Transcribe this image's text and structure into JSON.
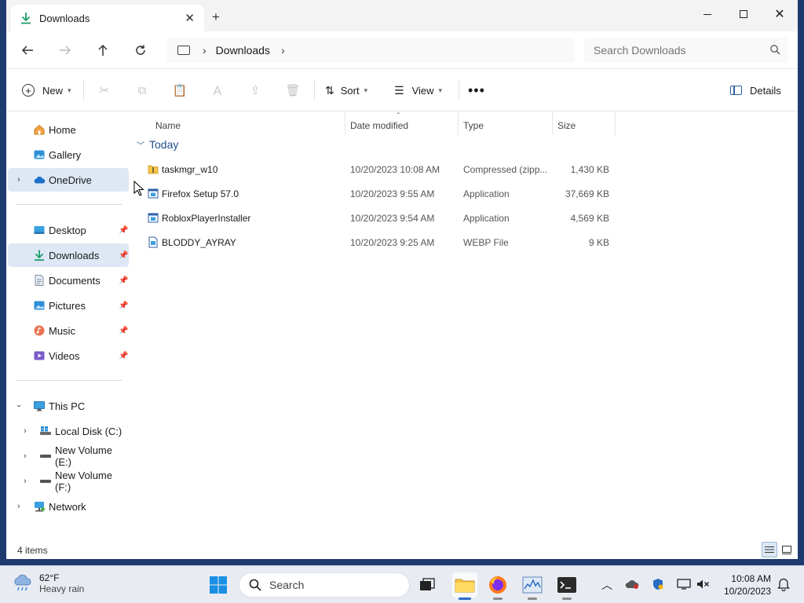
{
  "window": {
    "tab_title": "Downloads",
    "new_tab_symbol": "+"
  },
  "address_bar": {
    "crumbs": [
      "Downloads"
    ],
    "search_placeholder": "Search Downloads"
  },
  "toolbar": {
    "new_label": "New",
    "sort_label": "Sort",
    "view_label": "View",
    "more_label": "•••",
    "details_label": "Details"
  },
  "sidebar": {
    "quick": [
      {
        "label": "Home",
        "icon": "home-icon"
      },
      {
        "label": "Gallery",
        "icon": "gallery-icon"
      },
      {
        "label": "OneDrive",
        "icon": "cloud-icon"
      }
    ],
    "pinned": [
      {
        "label": "Desktop",
        "icon": "desktop-icon"
      },
      {
        "label": "Downloads",
        "icon": "download-icon",
        "selected": true
      },
      {
        "label": "Documents",
        "icon": "documents-icon"
      },
      {
        "label": "Pictures",
        "icon": "pictures-icon"
      },
      {
        "label": "Music",
        "icon": "music-icon"
      },
      {
        "label": "Videos",
        "icon": "videos-icon"
      }
    ],
    "devices": [
      {
        "label": "This PC",
        "icon": "pc-icon"
      },
      {
        "label": "Local Disk (C:)",
        "icon": "drive-icon"
      },
      {
        "label": "New Volume (E:)",
        "icon": "drive-icon"
      },
      {
        "label": "New Volume (F:)",
        "icon": "drive-icon"
      },
      {
        "label": "Network",
        "icon": "network-icon"
      }
    ]
  },
  "file_list": {
    "columns": [
      "Name",
      "Date modified",
      "Type",
      "Size"
    ],
    "group_label": "Today",
    "rows": [
      {
        "name": "taskmgr_w10",
        "date": "10/20/2023 10:08 AM",
        "type": "Compressed (zipp...",
        "size": "1,430 KB",
        "icon": "zip-folder-icon"
      },
      {
        "name": "Firefox Setup 57.0",
        "date": "10/20/2023 9:55 AM",
        "type": "Application",
        "size": "37,669 KB",
        "icon": "application-icon"
      },
      {
        "name": "RobloxPlayerInstaller",
        "date": "10/20/2023 9:54 AM",
        "type": "Application",
        "size": "4,569 KB",
        "icon": "application-icon"
      },
      {
        "name": "BLODDY_AYRAY",
        "date": "10/20/2023 9:25 AM",
        "type": "WEBP File",
        "size": "9 KB",
        "icon": "image-file-icon"
      }
    ]
  },
  "status": {
    "item_count": "4 items"
  },
  "taskbar": {
    "weather_temp": "62°F",
    "weather_cond": "Heavy rain",
    "search_label": "Search",
    "time": "10:08 AM",
    "date": "10/20/2023"
  },
  "colors": {
    "accent": "#2b6cc4",
    "selection": "#dde8f4",
    "group_header": "#1f4e8a"
  }
}
